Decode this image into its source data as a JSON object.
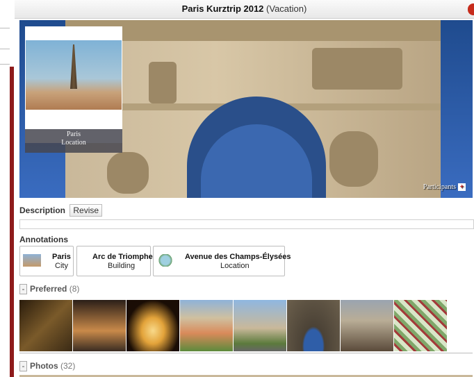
{
  "window": {
    "title": "Paris Kurztrip 2012",
    "type": "(Vacation)"
  },
  "hero": {
    "thumb_title": "Paris",
    "thumb_sub": "Location",
    "participants_label": "Participants"
  },
  "description": {
    "label": "Description",
    "revise_label": "Revise",
    "value": ""
  },
  "annotations": {
    "heading": "Annotations",
    "items": [
      {
        "name": "Paris",
        "type": "City",
        "icon": "paris-thumb-icon"
      },
      {
        "name": "Arc de Triomphe",
        "type": "Building",
        "icon": ""
      },
      {
        "name": "Avenue des Champs-Élysées",
        "type": "Location",
        "icon": "globe-icon"
      }
    ]
  },
  "preferred": {
    "toggle": "-",
    "label": "Preferred",
    "count": "(8)"
  },
  "photos": {
    "toggle": "-",
    "label": "Photos",
    "count": "(32)"
  },
  "preferred_thumbs": [
    {
      "name": "mona-lisa-photo",
      "colors": [
        "#3a2a15",
        "#7a5a2a"
      ]
    },
    {
      "name": "louvre-pyramid-photo",
      "colors": [
        "#2b1f18",
        "#c98a4a"
      ]
    },
    {
      "name": "eiffel-night-photo",
      "colors": [
        "#1a0d05",
        "#f0c060"
      ]
    },
    {
      "name": "palace-garden-photo",
      "colors": [
        "#8fb2d8",
        "#d98a5a"
      ]
    },
    {
      "name": "arc-de-triomphe-photo",
      "colors": [
        "#8fb7e0",
        "#c9b89a"
      ]
    },
    {
      "name": "arch-closeup-photo",
      "colors": [
        "#4b4236",
        "#2f5ea8"
      ]
    },
    {
      "name": "statue-photo",
      "colors": [
        "#9aa4b0",
        "#5a4a3a"
      ]
    },
    {
      "name": "map-photo",
      "colors": [
        "#d9e6c8",
        "#a33a3a"
      ]
    }
  ]
}
